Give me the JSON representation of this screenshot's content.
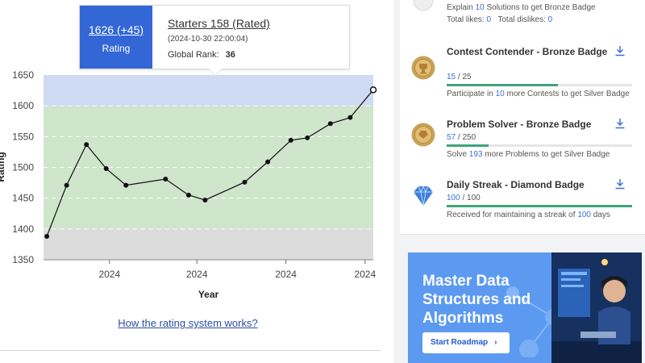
{
  "chart_data": {
    "type": "line",
    "title": "",
    "xlabel": "Year",
    "ylabel": "Rating",
    "ylim": [
      1350,
      1650
    ],
    "yticks": [
      1350,
      1400,
      1450,
      1500,
      1550,
      1600,
      1650
    ],
    "xtick_labels": [
      "2024",
      "2024",
      "2024",
      "2024"
    ],
    "bands": [
      {
        "from": 1350,
        "to": 1400,
        "color": "#dcdcdc"
      },
      {
        "from": 1400,
        "to": 1600,
        "color": "#cfe5cc"
      },
      {
        "from": 1600,
        "to": 1650,
        "color": "#cfdaf3"
      }
    ],
    "series": [
      {
        "line_color": "#111111",
        "values": [
          1388,
          1471,
          1537,
          1498,
          1471,
          1481,
          1455,
          1447,
          1476,
          1509,
          1544,
          1548,
          1571,
          1581,
          1626
        ],
        "x_pos": [
          0.01,
          0.07,
          0.13,
          0.19,
          0.25,
          0.37,
          0.44,
          0.49,
          0.61,
          0.68,
          0.75,
          0.8,
          0.87,
          0.93,
          1.0
        ]
      }
    ],
    "highlight_index": 14
  },
  "tooltip": {
    "rating": "1626 (+45)",
    "rating_label": "Rating",
    "contest": "Starters 158 (Rated)",
    "date": "(2024-10-30 22:00:04)",
    "rank_label": "Global Rank:",
    "rank_value": "36"
  },
  "rating_link": "How the rating system works?",
  "prev_badge": {
    "line1_a": "Explain ",
    "line1_num": "10",
    "line1_b": " Solutions to get Bronze Badge",
    "likes_label": "Total likes: ",
    "likes_value": "0",
    "dislikes_label": "Total dislikes: ",
    "dislikes_value": "0"
  },
  "badges": [
    {
      "title": "Contest Contender - Bronze Badge",
      "progress_current": "15",
      "progress_total": " / 25",
      "progress_fraction": 0.6,
      "note_a": "Participate in ",
      "note_num": "10",
      "note_b": " more Contests to get Silver Badge"
    },
    {
      "title": "Problem Solver - Bronze Badge",
      "progress_current": "57",
      "progress_total": " / 250",
      "progress_fraction": 0.228,
      "note_a": "Solve ",
      "note_num": "193",
      "note_b": " more Problems to get Silver Badge"
    },
    {
      "title": "Daily Streak - Diamond Badge",
      "progress_current": "100",
      "progress_total": " / 100",
      "progress_fraction": 1.0,
      "note_a": "Received for maintaining a streak of ",
      "note_num": "100",
      "note_b": " days"
    }
  ],
  "banner": {
    "headline": "Master Data Structures and Algorithms",
    "button": "Start Roadmap"
  }
}
